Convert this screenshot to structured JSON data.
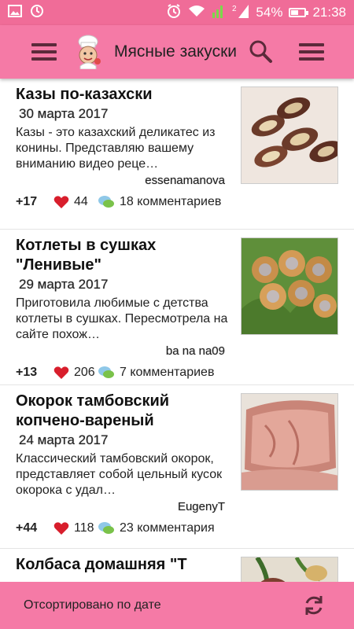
{
  "statusbar": {
    "battery": "54%",
    "time": "21:38",
    "battery_level": 0.54
  },
  "appbar": {
    "title": "Мясные закуски"
  },
  "items": [
    {
      "title": "Казы по-казахски",
      "date": "30 марта 2017",
      "description": "Казы - это казахский деликатес из конины. Представляю вашему вниманию видео реце…",
      "author": "essenamanova",
      "score": "+17",
      "likes": "44",
      "comments": "18 комментариев"
    },
    {
      "title": "Котлеты в сушках \"Ленивые\"",
      "date": "29 марта 2017",
      "description": "Приготовила любимые с детства котлеты в сушках. Пересмотрела на сайте похож…",
      "author": "ba na na09",
      "score": "+13",
      "likes": "206",
      "comments": "7 комментариев"
    },
    {
      "title": "Окорок тамбовский копчено-вареный",
      "date": "24 марта 2017",
      "description": "Классический тамбовский окорок, представляет собой цельный кусок окорока с удал…",
      "author": "EugenyT",
      "score": "+44",
      "likes": "118",
      "comments": "23 комментария"
    },
    {
      "title": "Колбаса домашняя \"Т",
      "date": "",
      "description": "",
      "author": "",
      "score": "",
      "likes": "",
      "comments": ""
    }
  ],
  "bottombar": {
    "sort_label": "Отсортировано по дате"
  },
  "colors": {
    "primary": "#f57aa6",
    "status": "#f06c98",
    "heart": "#d81e2c"
  }
}
